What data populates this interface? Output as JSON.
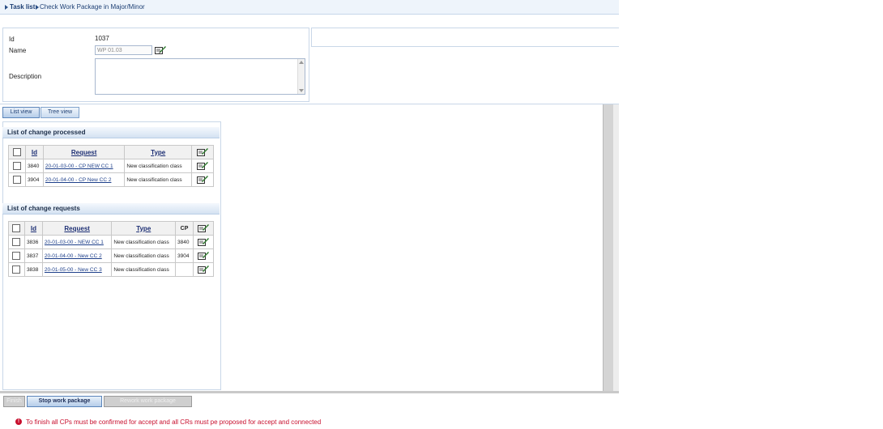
{
  "breadcrumb": {
    "root": "Task list",
    "current": "Check Work Package in Major/Minor"
  },
  "props": {
    "id_label": "Id",
    "id_value": "1037",
    "name_label": "Name",
    "name_value": "WP 01.03",
    "description_label": "Description"
  },
  "tabs": [
    {
      "label": "List view"
    },
    {
      "label": "Tree view"
    }
  ],
  "processed": {
    "title": "List of change processed",
    "headers": {
      "id": "Id",
      "request": "Request",
      "type": "Type"
    },
    "rows": [
      {
        "id": "3840",
        "request": "20-01-03-00 - CP NEW CC 1",
        "type": "New classification class"
      },
      {
        "id": "3904",
        "request": "20-01-04-00 - CP New CC 2",
        "type": "New classification class"
      }
    ]
  },
  "requests": {
    "title": "List of change requests",
    "headers": {
      "id": "Id",
      "request": "Request",
      "type": "Type",
      "cp": "CP"
    },
    "rows": [
      {
        "id": "3836",
        "request": "20-01-03-00 - NEW CC 1",
        "type": "New classification class",
        "cp": "3840"
      },
      {
        "id": "3837",
        "request": "20-01-04-00 - New CC 2",
        "type": "New classification class",
        "cp": "3904"
      },
      {
        "id": "3838",
        "request": "20-01-05-00 - New CC 3",
        "type": "New classification class",
        "cp": ""
      }
    ]
  },
  "buttons": {
    "finish": "Finish",
    "stop": "Stop work package",
    "rework": "Rework work package"
  },
  "warning": "To finish all CPs must be confirmed for accept and all CRs must pe proposed for accept and connected",
  "icons": {
    "edit": "edit-pencil-icon",
    "warning": "error-icon"
  },
  "colors": {
    "accent": "#1d3f74",
    "warning": "#c8102e"
  }
}
